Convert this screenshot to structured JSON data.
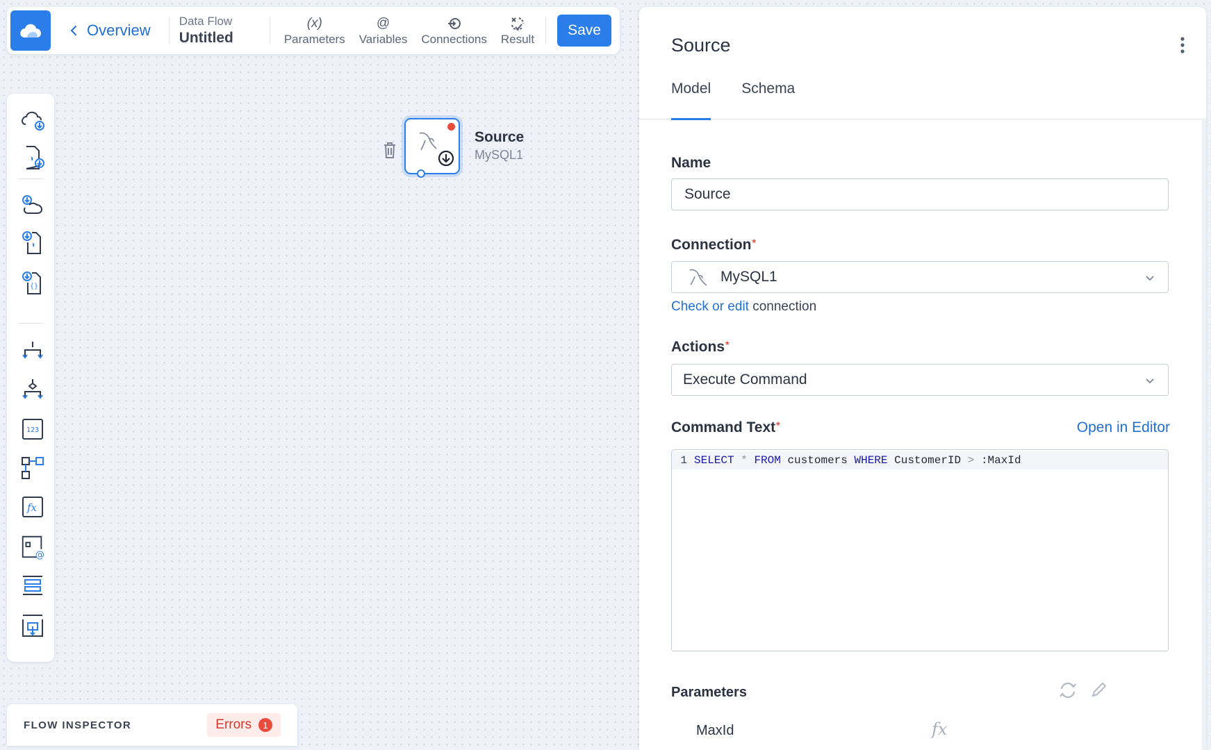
{
  "app": {
    "back_label": "Overview",
    "flow_kind": "Data Flow",
    "flow_name": "Untitled",
    "save_label": "Save",
    "logo_icon": "cloud-logo-icon"
  },
  "toolbar": {
    "items": [
      {
        "label": "Parameters",
        "glyph": "(x)",
        "icon": "parameters-icon"
      },
      {
        "label": "Variables",
        "glyph": "@",
        "icon": "variables-icon"
      },
      {
        "label": "Connections",
        "icon": "connections-icon"
      },
      {
        "label": "Result",
        "icon": "result-icon"
      }
    ]
  },
  "palette": {
    "icons": [
      "cloud-source-icon",
      "file-source-icon",
      "cloud-target-icon",
      "file-target-icon",
      "json-target-icon",
      "split-icon",
      "merge-icon",
      "row-count-icon",
      "lookup-icon",
      "expression-icon",
      "variable-icon",
      "buffer-icon",
      "output-icon"
    ]
  },
  "canvas": {
    "node": {
      "title": "Source",
      "subtitle": "MySQL1",
      "icon": "mysql-dolphin-icon",
      "has_error": true
    }
  },
  "inspector": {
    "title": "FLOW INSPECTOR",
    "errors_label": "Errors",
    "errors_count": "1"
  },
  "panel": {
    "title": "Source",
    "tabs": [
      {
        "label": "Model",
        "active": true
      },
      {
        "label": "Schema",
        "active": false
      }
    ],
    "name": {
      "label": "Name",
      "value": "Source"
    },
    "connection": {
      "label": "Connection",
      "required_mark": "*",
      "value": "MySQL1",
      "helper_link": "Check or edit",
      "helper_rest": " connection"
    },
    "actions": {
      "label": "Actions",
      "required_mark": "*",
      "value": "Execute Command"
    },
    "command": {
      "label": "Command Text",
      "required_mark": "*",
      "open_editor_label": "Open in Editor",
      "line_number": "1",
      "tokens": {
        "t1": "SELECT",
        "t2": "*",
        "t3": "FROM",
        "t4": "customers",
        "t5": "WHERE",
        "t6": "CustomerID",
        "t7": ">",
        "t8": ":MaxId"
      }
    },
    "parameters": {
      "label": "Parameters",
      "items": [
        {
          "name": "MaxId",
          "value_glyph": "fx"
        }
      ]
    }
  },
  "colors": {
    "accent": "#2b7de9",
    "error": "#e94b3c",
    "link": "#1f6fd6"
  }
}
